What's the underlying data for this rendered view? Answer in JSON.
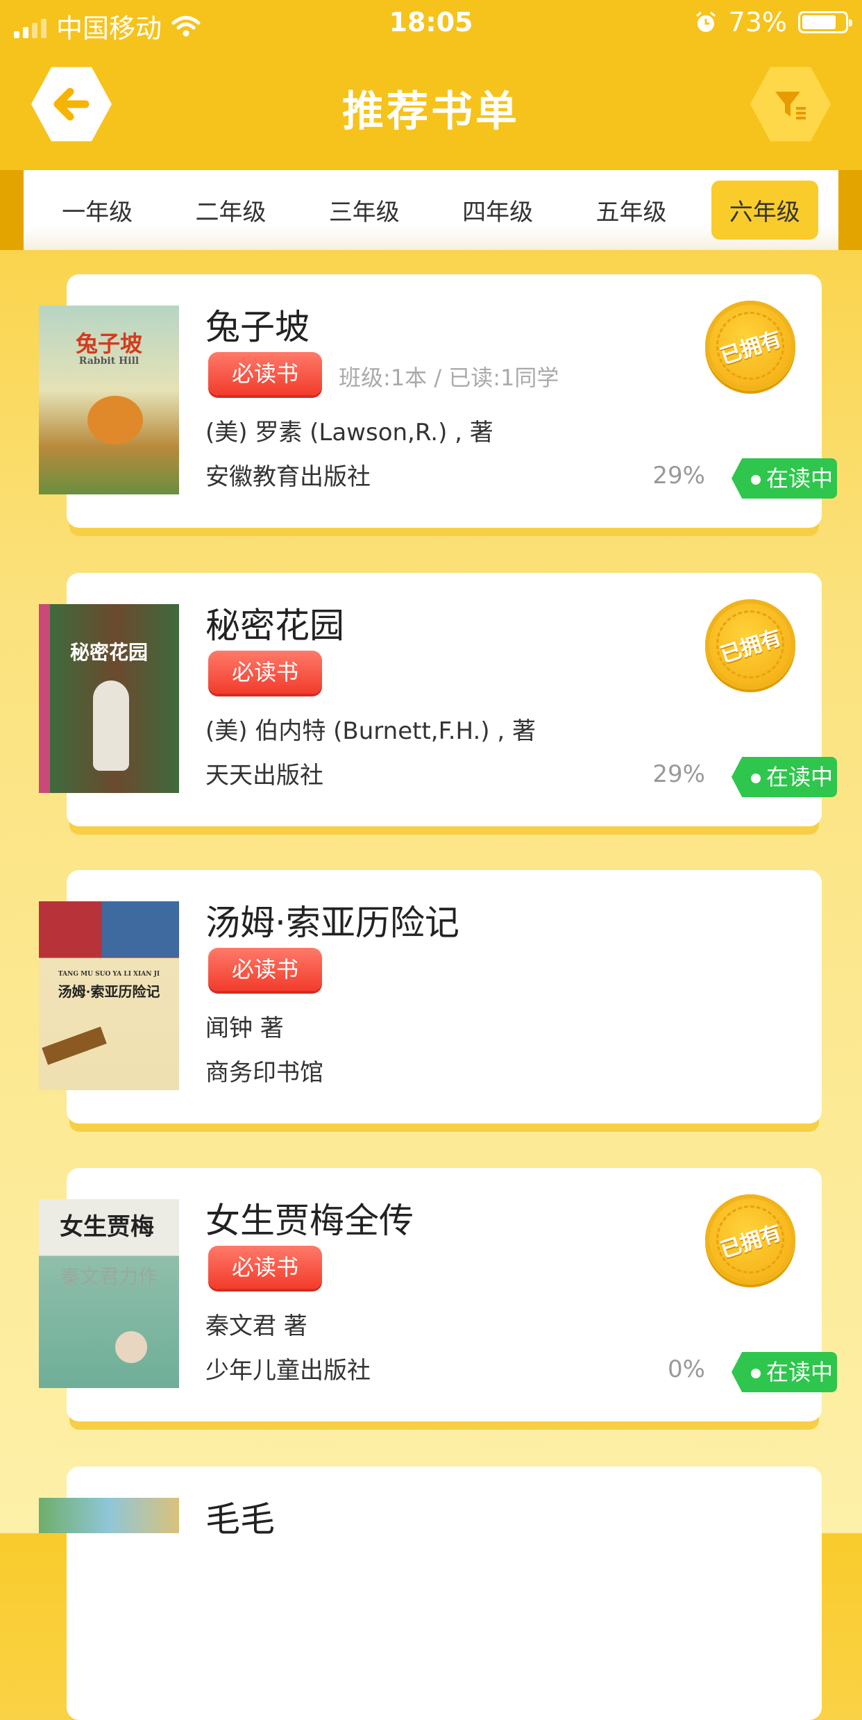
{
  "status": {
    "carrier": "中国移动",
    "time": "18:05",
    "battery": "73%",
    "battery_level": 0.73
  },
  "header": {
    "title": "推荐书单",
    "back_icon": "back-arrow-icon",
    "filter_icon": "filter-icon"
  },
  "tabs": [
    {
      "label": "一年级"
    },
    {
      "label": "二年级"
    },
    {
      "label": "三年级"
    },
    {
      "label": "四年级"
    },
    {
      "label": "五年级"
    },
    {
      "label": "六年级",
      "active": true
    }
  ],
  "books": [
    {
      "title": "兔子坡",
      "tag": "必读书",
      "stats": "班级:1本 / 已读:1同学",
      "author": "(美) 罗素 (Lawson,R.) , 著",
      "publisher": "安徽教育出版社",
      "percent": "29%",
      "status": "在读中",
      "owned": "已拥有",
      "cover_title": "兔子坡",
      "cover_sub": "Rabbit Hill"
    },
    {
      "title": "秘密花园",
      "tag": "必读书",
      "stats": "",
      "author": "(美) 伯内特 (Burnett,F.H.) , 著",
      "publisher": "天天出版社",
      "percent": "29%",
      "status": "在读中",
      "owned": "已拥有",
      "cover_title": "秘密花园",
      "cover_sub": ""
    },
    {
      "title": "汤姆·索亚历险记",
      "tag": "必读书",
      "stats": "",
      "author": "闻钟 著",
      "publisher": "商务印书馆",
      "percent": "",
      "status": "",
      "owned": "",
      "cover_title": "汤姆·索亚历险记",
      "cover_sub": "TANG MU SUO YA LI XIAN JI"
    },
    {
      "title": "女生贾梅全传",
      "tag": "必读书",
      "stats": "",
      "author": "秦文君 著",
      "publisher": "少年儿童出版社",
      "percent": "0%",
      "status": "在读中",
      "owned": "已拥有",
      "cover_title": "女生贾梅",
      "cover_sub": "秦文君力作"
    },
    {
      "title": "毛毛",
      "tag": "",
      "stats": "",
      "author": "",
      "publisher": "",
      "percent": "",
      "status": "",
      "owned": "",
      "cover_title": "",
      "cover_sub": ""
    }
  ],
  "colors": {
    "header": "#f6c31c",
    "reading": "#2ec64c",
    "tag": "#f23c2c",
    "active_tab": "#f9cc2c"
  }
}
